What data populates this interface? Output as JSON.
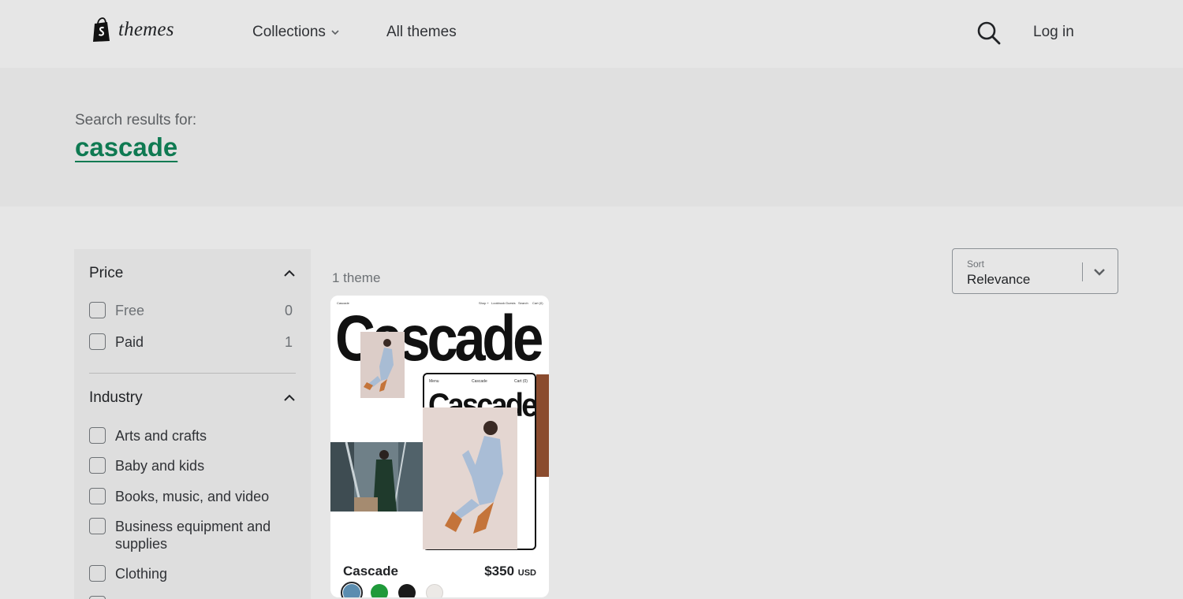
{
  "header": {
    "logo_text": "themes",
    "nav": [
      {
        "label": "Collections"
      },
      {
        "label": "All themes"
      }
    ],
    "login_label": "Log in",
    "icons": {
      "search": "search-icon",
      "logo": "shopify-bag-icon",
      "collections_chevron": "chevron-down-icon"
    }
  },
  "search": {
    "label": "Search results for:",
    "term": "cascade"
  },
  "filters": {
    "price": {
      "title": "Price",
      "options": [
        {
          "label": "Free",
          "count": "0"
        },
        {
          "label": "Paid",
          "count": "1"
        }
      ]
    },
    "industry": {
      "title": "Industry",
      "options": [
        {
          "label": "Arts and crafts"
        },
        {
          "label": "Baby and kids"
        },
        {
          "label": "Books, music, and video"
        },
        {
          "label": "Business equipment and supplies"
        },
        {
          "label": "Clothing"
        }
      ]
    }
  },
  "results": {
    "count_label": "1 theme",
    "sort": {
      "label": "Sort",
      "value": "Relevance"
    }
  },
  "theme_card": {
    "preview": {
      "brand": "Cascade",
      "top_nav": [
        "Shop +",
        "Lookbook",
        "Guests",
        "Search",
        "Cart (0)"
      ],
      "headline": "Cascade",
      "mobile_nav": [
        "Menu",
        "Cascade",
        "Cart (0)"
      ],
      "mobile_headline": "Cascade"
    },
    "name": "Cascade",
    "price": "$350",
    "currency": "USD",
    "swatches": [
      {
        "name": "blue",
        "color": "#5b8db0",
        "active": true
      },
      {
        "name": "green",
        "color": "#1f9a3a",
        "active": false
      },
      {
        "name": "black",
        "color": "#1a1a1a",
        "active": false
      },
      {
        "name": "light",
        "color": "#ece9e6",
        "active": false
      }
    ]
  },
  "colors": {
    "accent": "#0f7a52",
    "page_bg": "#e6e6e6",
    "banner_bg": "#e0e0e0"
  }
}
